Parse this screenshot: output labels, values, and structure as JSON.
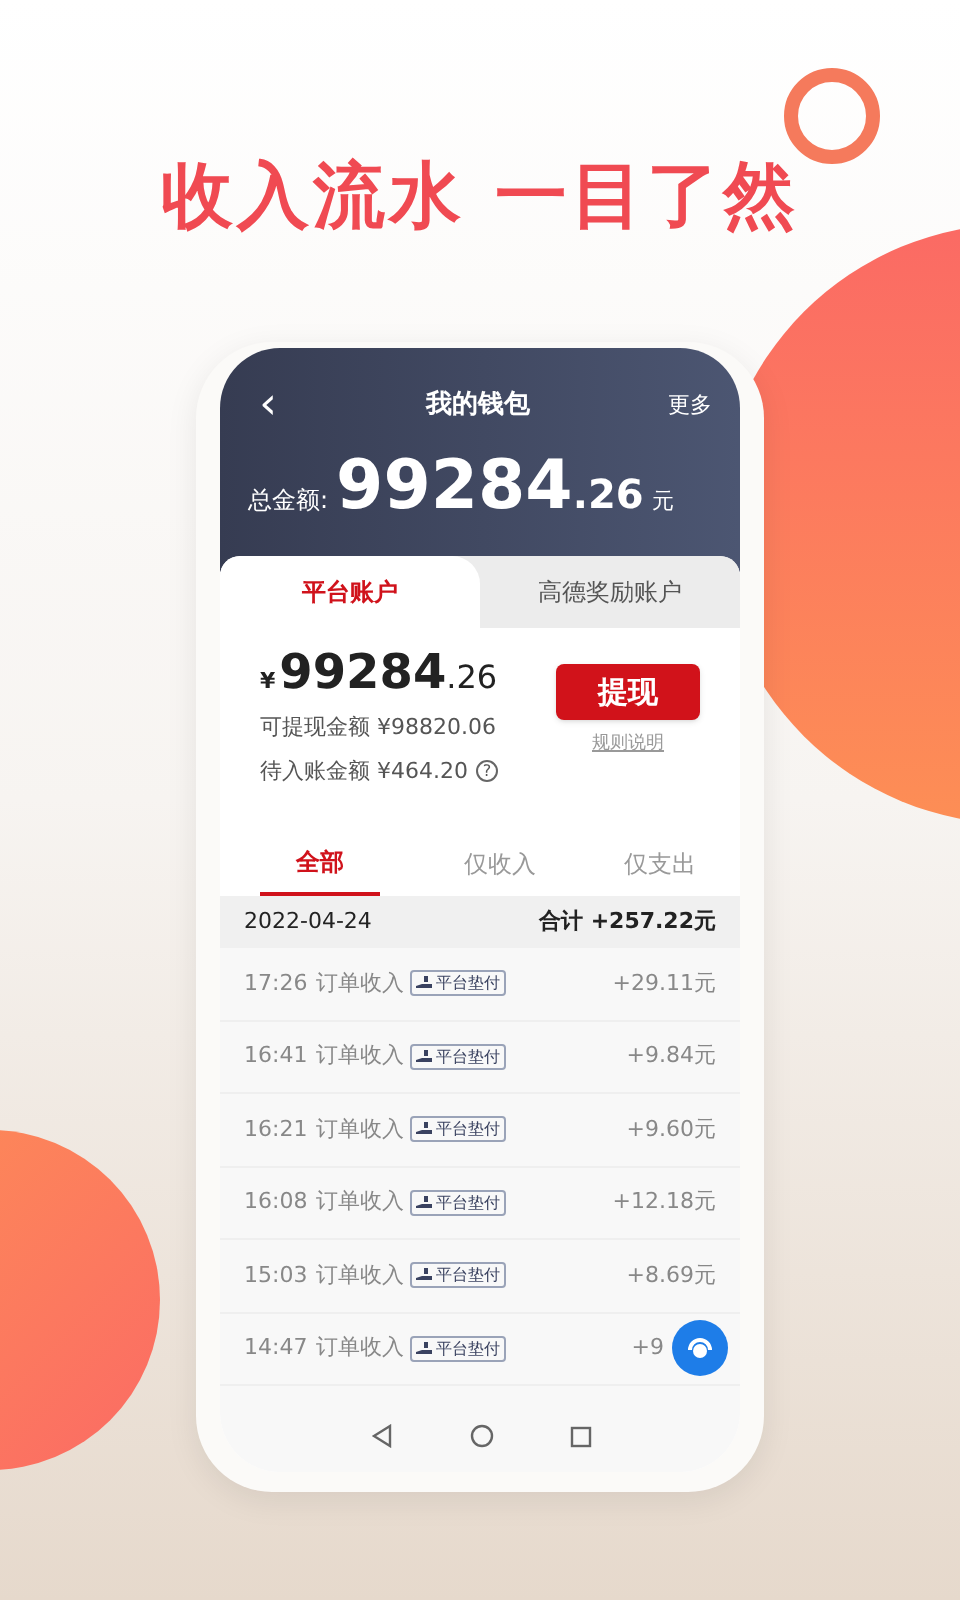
{
  "headline": "收入流水 一目了然",
  "header": {
    "back": "‹",
    "title": "我的钱包",
    "more": "更多",
    "total_label": "总金额:",
    "total_int": "99284",
    "total_dec": ".26",
    "unit": "元"
  },
  "account_tabs": [
    {
      "label": "平台账户",
      "selected": true
    },
    {
      "label": "高德奖励账户",
      "selected": false
    }
  ],
  "balance": {
    "currency": "¥",
    "int": "99284",
    "dec": ".26",
    "withdrawable": "可提现金额 ¥98820.06",
    "pending": "待入账金额 ¥464.20",
    "help": "?",
    "button": "提现",
    "rules": "规则说明"
  },
  "filters": [
    {
      "label": "全部",
      "selected": true
    },
    {
      "label": "仅收入",
      "selected": false
    },
    {
      "label": "仅支出",
      "selected": false
    }
  ],
  "date_row": {
    "date": "2022-04-24",
    "total": "合计 +257.22元"
  },
  "rows": [
    {
      "time": "17:26",
      "type": "订单收入",
      "badge": "平台垫付",
      "amount": "+29.11元"
    },
    {
      "time": "16:41",
      "type": "订单收入",
      "badge": "平台垫付",
      "amount": "+9.84元"
    },
    {
      "time": "16:21",
      "type": "订单收入",
      "badge": "平台垫付",
      "amount": "+9.60元"
    },
    {
      "time": "16:08",
      "type": "订单收入",
      "badge": "平台垫付",
      "amount": "+12.18元"
    },
    {
      "time": "15:03",
      "type": "订单收入",
      "badge": "平台垫付",
      "amount": "+8.69元"
    },
    {
      "time": "14:47",
      "type": "订单收入",
      "badge": "平台垫付",
      "amount": "+9"
    }
  ]
}
